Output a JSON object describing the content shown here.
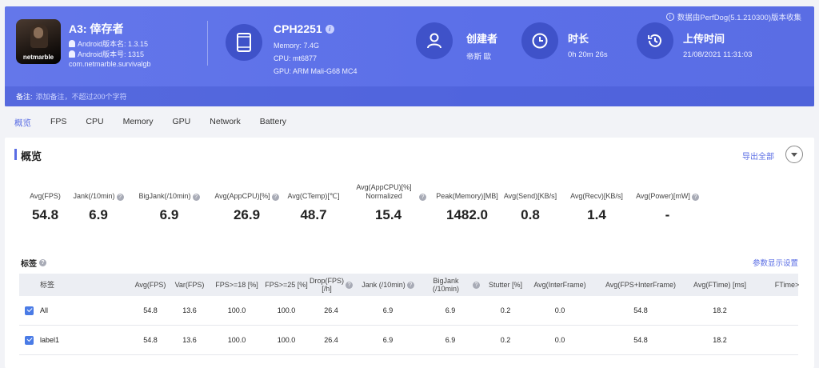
{
  "header": {
    "notice": "数据由PerfDog(5.1.210300)版本收集",
    "app": {
      "icon_text": "netmarble",
      "title": "A3: 倖存者",
      "version_name": "Android版本名: 1.3.15",
      "version_code": "Android版本号: 1315",
      "package": "com.netmarble.survivalgb"
    },
    "device": {
      "model": "CPH2251",
      "memory": "Memory: 7.4G",
      "cpu": "CPU: mt6877",
      "gpu": "GPU: ARM Mali-G68 MC4"
    },
    "creator": {
      "title": "创建者",
      "value": "帝斯 歐"
    },
    "duration": {
      "title": "时长",
      "value": "0h 20m 26s"
    },
    "upload": {
      "title": "上传时间",
      "value": "21/08/2021 11:31:03"
    },
    "note": {
      "label": "备注:",
      "placeholder": "添加备注，不超过200个字符"
    }
  },
  "tabs": [
    "概览",
    "FPS",
    "CPU",
    "Memory",
    "GPU",
    "Network",
    "Battery"
  ],
  "overview": {
    "title": "概览",
    "export": "导出全部",
    "metrics": [
      {
        "label": "Avg(FPS)",
        "value": "54.8",
        "help": false
      },
      {
        "label": "Jank(/10min)",
        "value": "6.9",
        "help": true
      },
      {
        "label": "BigJank(/10min)",
        "value": "6.9",
        "help": true
      },
      {
        "label": "Avg(AppCPU)[%]",
        "value": "26.9",
        "help": true
      },
      {
        "label": "Avg(CTemp)[℃]",
        "value": "48.7",
        "help": false
      },
      {
        "label": "Avg(AppCPU)[%] Normalized",
        "value": "15.4",
        "help": true
      },
      {
        "label": "Peak(Memory)[MB]",
        "value": "1482.0",
        "help": false
      },
      {
        "label": "Avg(Send)[KB/s]",
        "value": "0.8",
        "help": false
      },
      {
        "label": "Avg(Recv)[KB/s]",
        "value": "1.4",
        "help": false
      },
      {
        "label": "Avg(Power)[mW]",
        "value": "-",
        "help": true
      }
    ]
  },
  "tags": {
    "title": "标签",
    "param_link": "参数显示设置",
    "columns": [
      {
        "label": "标签"
      },
      {
        "label": "Avg(FPS)"
      },
      {
        "label": "Var(FPS)"
      },
      {
        "label": "FPS>=18 [%]"
      },
      {
        "label": "FPS>=25 [%]"
      },
      {
        "label": "Drop(FPS) [/h]"
      },
      {
        "label": "Jank (/10min)"
      },
      {
        "label": "BigJank (/10min)"
      },
      {
        "label": "Stutter [%]"
      },
      {
        "label": "Avg(InterFrame)"
      },
      {
        "label": "Avg(FPS+InterFrame)"
      },
      {
        "label": "Avg(FTime) [ms]"
      },
      {
        "label": "FTime>"
      }
    ],
    "rows": [
      {
        "checked": true,
        "cells": [
          "All",
          "54.8",
          "13.6",
          "100.0",
          "100.0",
          "26.4",
          "6.9",
          "6.9",
          "0.2",
          "0.0",
          "54.8",
          "18.2",
          ""
        ]
      },
      {
        "checked": true,
        "cells": [
          "label1",
          "54.8",
          "13.6",
          "100.0",
          "100.0",
          "26.4",
          "6.9",
          "6.9",
          "0.2",
          "0.0",
          "54.8",
          "18.2",
          ""
        ]
      }
    ]
  },
  "colors": {
    "accent": "#5a6de4",
    "header_bg": "#6477ea",
    "icon_circle": "#3f52c9",
    "checkbox": "#4a7be6"
  }
}
